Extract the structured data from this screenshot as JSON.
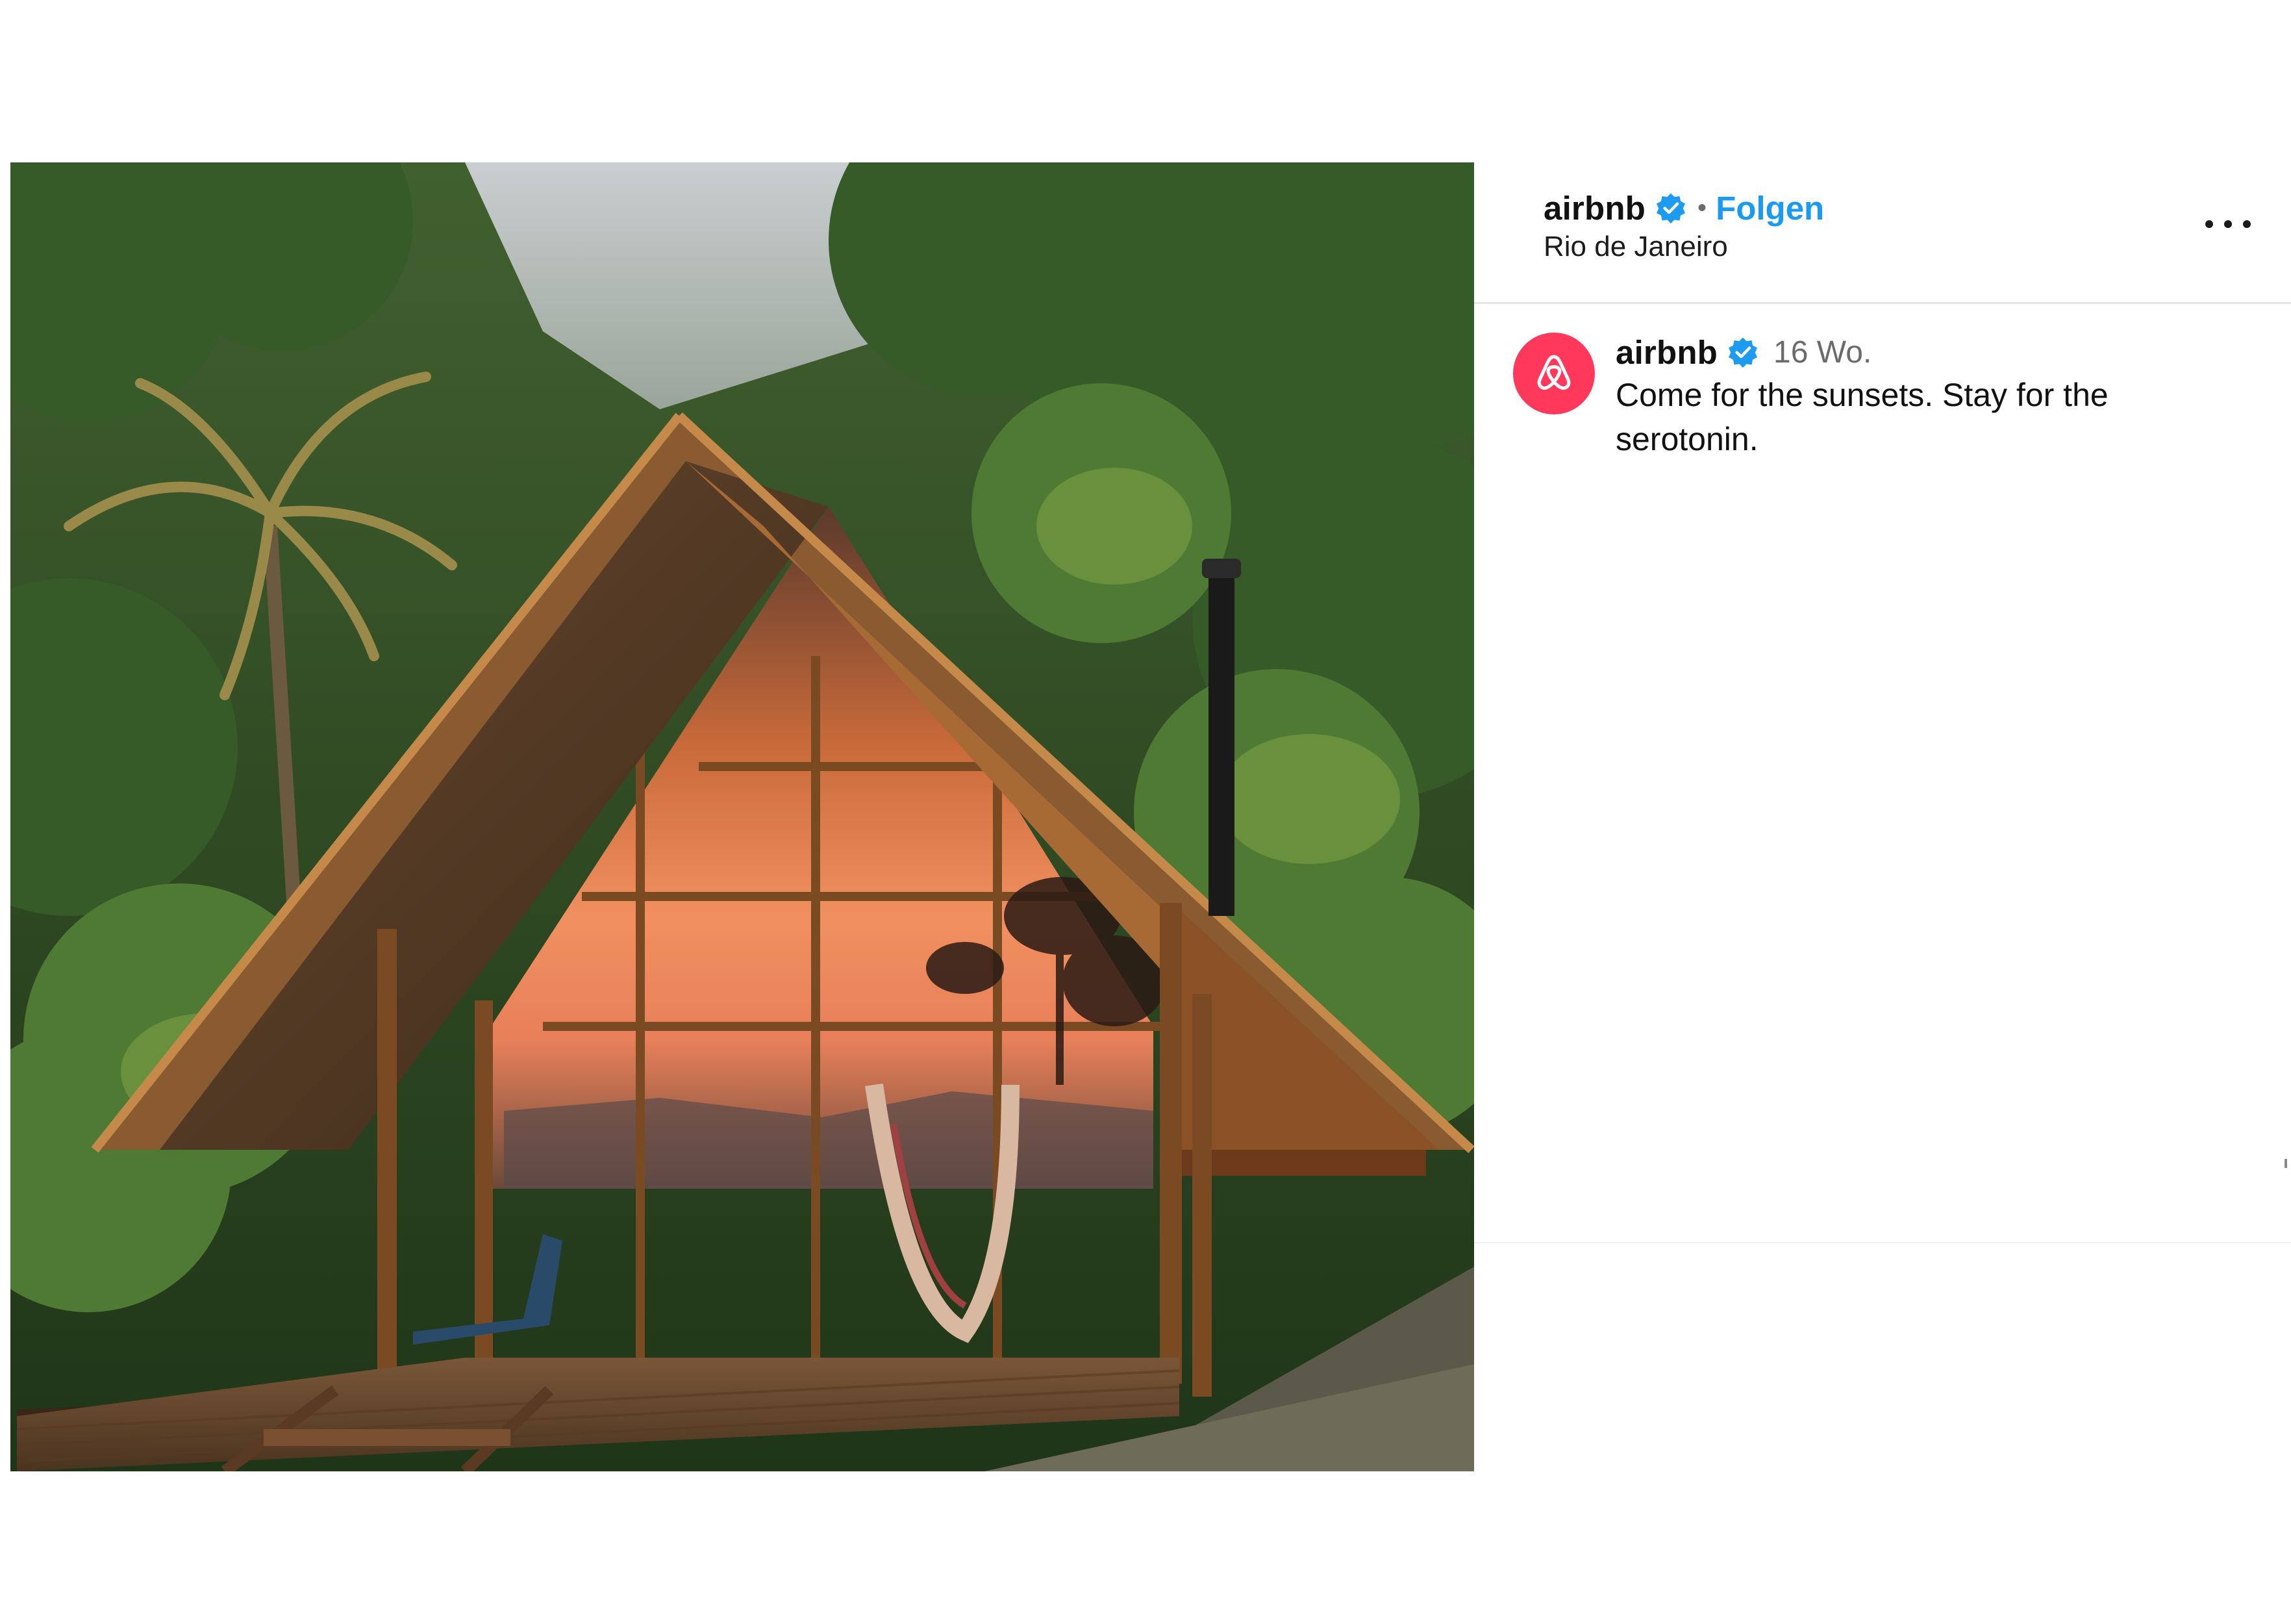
{
  "post": {
    "account": {
      "username": "airbnb",
      "verified": true,
      "follow_label": "Folgen",
      "separator": "•",
      "location": "Rio de Janeiro"
    },
    "more_icon": "more-options-icon",
    "image_alt": "A-frame wooden cabin in a tropical rainforest with glass front reflecting a sunset, deck with a blue lounge chair and a hammock",
    "caption_comment": {
      "username": "airbnb",
      "verified": true,
      "time_ago": "16 Wo.",
      "text": "Come for the sunsets. Stay for the serotonin.",
      "avatar_icon": "airbnb-logo-icon"
    }
  },
  "colors": {
    "follow_blue": "#1a9af0",
    "verified_blue": "#1d9bf0",
    "airbnb_red": "#ff385c",
    "secondary_text": "#6b6b6b",
    "divider": "#e6e6e6"
  }
}
